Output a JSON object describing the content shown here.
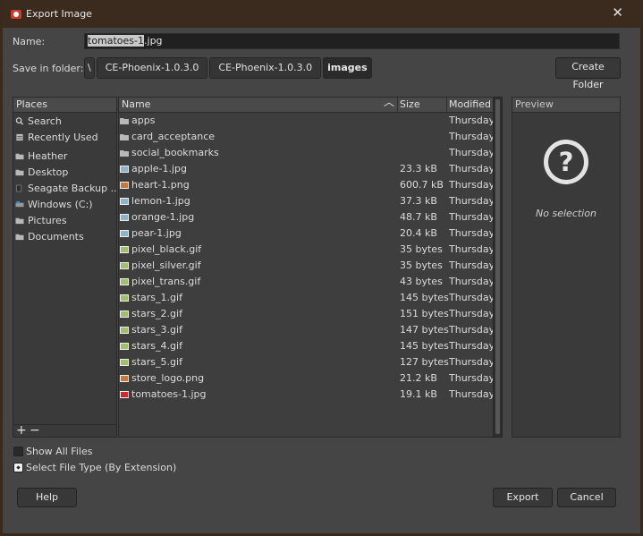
{
  "window": {
    "title": "Export Image",
    "close_glyph": "✕"
  },
  "name_row": {
    "label": "Name:",
    "value_selected": "tomatoes-1",
    "value_rest": ".jpg"
  },
  "folder_row": {
    "label": "Save in folder:",
    "crumbs": [
      "\\",
      "CE-Phoenix-1.0.3.0",
      "CE-Phoenix-1.0.3.0",
      "images"
    ],
    "create_folder": "Create Folder"
  },
  "places": {
    "header": "Places",
    "items": [
      {
        "label": "Search",
        "icon": "search-icon"
      },
      {
        "label": "Recently Used",
        "icon": "recent-icon"
      },
      {
        "label": "Heather",
        "icon": "home-folder-icon"
      },
      {
        "label": "Desktop",
        "icon": "desktop-folder-icon"
      },
      {
        "label": "Seagate Backup ...",
        "icon": "drive-icon"
      },
      {
        "label": "Windows (C:)",
        "icon": "windows-drive-icon"
      },
      {
        "label": "Pictures",
        "icon": "folder-icon"
      },
      {
        "label": "Documents",
        "icon": "folder-icon"
      }
    ],
    "add": "+",
    "remove": "−"
  },
  "files": {
    "columns": {
      "name": "Name",
      "size": "Size",
      "modified": "Modified",
      "sort_glyph": "︿"
    },
    "rows": [
      {
        "name": "apps",
        "size": "",
        "modified": "Thursday",
        "icon": "folder"
      },
      {
        "name": "card_acceptance",
        "size": "",
        "modified": "Thursday",
        "icon": "folder"
      },
      {
        "name": "social_bookmarks",
        "size": "",
        "modified": "Thursday",
        "icon": "folder"
      },
      {
        "name": "apple-1.jpg",
        "size": "23.3 kB",
        "modified": "Thursday",
        "icon": "image"
      },
      {
        "name": "heart-1.png",
        "size": "600.7 kB",
        "modified": "Thursday",
        "icon": "png"
      },
      {
        "name": "lemon-1.jpg",
        "size": "37.3 kB",
        "modified": "Thursday",
        "icon": "image"
      },
      {
        "name": "orange-1.jpg",
        "size": "48.7 kB",
        "modified": "Thursday",
        "icon": "image"
      },
      {
        "name": "pear-1.jpg",
        "size": "20.4 kB",
        "modified": "Thursday",
        "icon": "image"
      },
      {
        "name": "pixel_black.gif",
        "size": "35 bytes",
        "modified": "Thursday",
        "icon": "gif"
      },
      {
        "name": "pixel_silver.gif",
        "size": "35 bytes",
        "modified": "Thursday",
        "icon": "gif"
      },
      {
        "name": "pixel_trans.gif",
        "size": "43 bytes",
        "modified": "Thursday",
        "icon": "gif"
      },
      {
        "name": "stars_1.gif",
        "size": "145 bytes",
        "modified": "Thursday",
        "icon": "gif"
      },
      {
        "name": "stars_2.gif",
        "size": "151 bytes",
        "modified": "Thursday",
        "icon": "gif"
      },
      {
        "name": "stars_3.gif",
        "size": "147 bytes",
        "modified": "Thursday",
        "icon": "gif"
      },
      {
        "name": "stars_4.gif",
        "size": "145 bytes",
        "modified": "Thursday",
        "icon": "gif"
      },
      {
        "name": "stars_5.gif",
        "size": "127 bytes",
        "modified": "Thursday",
        "icon": "gif"
      },
      {
        "name": "store_logo.png",
        "size": "21.2 kB",
        "modified": "Thursday",
        "icon": "png"
      },
      {
        "name": "tomatoes-1.jpg",
        "size": "19.1 kB",
        "modified": "Thursday",
        "icon": "tomato"
      }
    ]
  },
  "preview": {
    "header": "Preview",
    "icon_glyph": "?",
    "message": "No selection"
  },
  "options": {
    "show_all_files": "Show All Files",
    "select_file_type": "Select File Type (By Extension)"
  },
  "buttons": {
    "help": "Help",
    "export": "Export",
    "cancel": "Cancel"
  },
  "colors": {
    "titlebar": "#3b2b1f",
    "gimp_icon": "#d0392b",
    "folder_icon": "#b8b8b8",
    "image_icon": "#8fb3c9",
    "png_icon": "#c87a3c",
    "gif_icon": "#9fbf6a",
    "tomato_icon": "#d7262b"
  }
}
